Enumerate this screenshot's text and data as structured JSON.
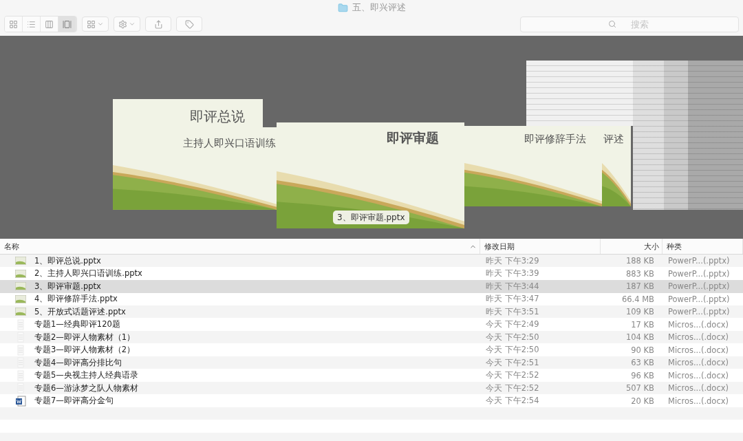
{
  "window": {
    "title": "五、即兴评述"
  },
  "toolbar": {
    "view_buttons": [
      {
        "kind": "icons",
        "selected": false
      },
      {
        "kind": "list",
        "selected": false
      },
      {
        "kind": "columns",
        "selected": false
      },
      {
        "kind": "coverflow",
        "selected": true
      }
    ]
  },
  "search": {
    "placeholder": "搜索"
  },
  "coverflow": {
    "items": [
      {
        "kind": "slide",
        "title": "即评总说"
      },
      {
        "kind": "slide",
        "title": "主持人即兴口语训练"
      },
      {
        "kind": "slide",
        "title": "即评审题"
      },
      {
        "kind": "slide",
        "title": "即评修辞手法"
      },
      {
        "kind": "slide",
        "title": "评述"
      },
      {
        "kind": "document"
      },
      {
        "kind": "document"
      },
      {
        "kind": "document"
      },
      {
        "kind": "document"
      }
    ],
    "caption": "3、即评审题.pptx"
  },
  "columns": [
    {
      "label": "名称",
      "sorted": true
    },
    {
      "label": "修改日期",
      "sorted": false
    },
    {
      "label": "大小",
      "sorted": false
    },
    {
      "label": "种类",
      "sorted": false
    }
  ],
  "files": [
    {
      "kind": "pptx",
      "name": "1、即评总说.pptx",
      "date": "昨天 下午3:29",
      "size": "188 KB",
      "type": "PowerP...(.pptx)",
      "selected": false
    },
    {
      "kind": "pptx",
      "name": "2、主持人即兴口语训练.pptx",
      "date": "昨天 下午3:39",
      "size": "883 KB",
      "type": "PowerP...(.pptx)",
      "selected": false
    },
    {
      "kind": "pptx",
      "name": "3、即评审题.pptx",
      "date": "昨天 下午3:44",
      "size": "187 KB",
      "type": "PowerP...(.pptx)",
      "selected": true
    },
    {
      "kind": "pptx",
      "name": "4、即评修辞手法.pptx",
      "date": "昨天 下午3:47",
      "size": "66.4 MB",
      "type": "PowerP...(.pptx)",
      "selected": false
    },
    {
      "kind": "pptx",
      "name": "5、开放式话题评述.pptx",
      "date": "昨天 下午3:51",
      "size": "109 KB",
      "type": "PowerP...(.pptx)",
      "selected": false
    },
    {
      "kind": "doc",
      "name": "专题1—经典即评120题",
      "date": "今天 下午2:49",
      "size": "17 KB",
      "type": "Micros...(.docx)",
      "selected": false
    },
    {
      "kind": "doc",
      "name": "专题2—即评人物素材（1）",
      "date": "今天 下午2:50",
      "size": "104 KB",
      "type": "Micros...(.docx)",
      "selected": false
    },
    {
      "kind": "doc",
      "name": "专题3—即评人物素材（2）",
      "date": "今天 下午2:50",
      "size": "90 KB",
      "type": "Micros...(.docx)",
      "selected": false
    },
    {
      "kind": "doc",
      "name": "专题4—即评高分排比句",
      "date": "今天 下午2:51",
      "size": "63 KB",
      "type": "Micros...(.docx)",
      "selected": false
    },
    {
      "kind": "doc",
      "name": "专题5—央视主持人经典语录",
      "date": "今天 下午2:52",
      "size": "96 KB",
      "type": "Micros...(.docx)",
      "selected": false
    },
    {
      "kind": "doc",
      "name": "专题6—游泳梦之队人物素材",
      "date": "今天 下午2:52",
      "size": "507 KB",
      "type": "Micros...(.docx)",
      "selected": false
    },
    {
      "kind": "word",
      "name": "专题7—即评高分金句",
      "date": "今天 下午2:54",
      "size": "20 KB",
      "type": "Micros...(.docx)",
      "selected": false
    }
  ]
}
